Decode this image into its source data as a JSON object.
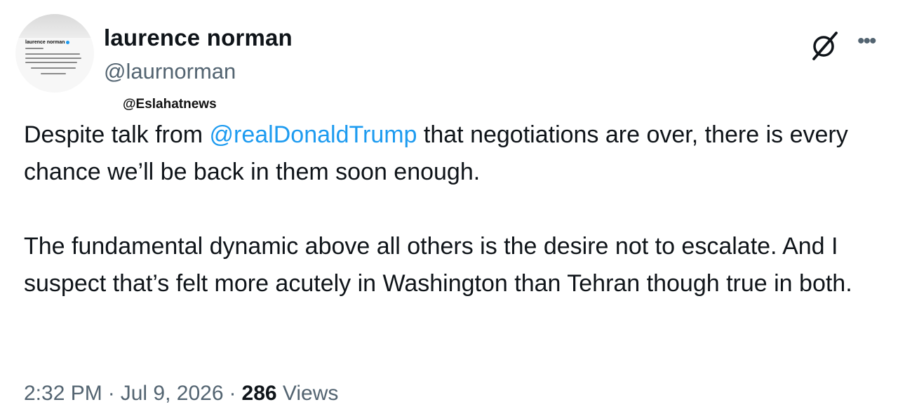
{
  "author": {
    "display_name": "laurence norman",
    "handle": "@laurnorman",
    "avatar_card_name": "laurence norman"
  },
  "watermark": "@Eslahatnews",
  "tweet": {
    "paragraph1_before": "Despite talk from ",
    "mention": "@realDonaldTrump",
    "paragraph1_after": " that negotiations are over, there is every chance we’ll be back in them soon enough.",
    "paragraph2": "The fundamental dynamic above all others is the desire not to escalate. And I suspect that’s felt more acutely in Washington than Tehran though true in both."
  },
  "meta": {
    "time": "2:32 PM",
    "separator": "·",
    "date": "Jul 9, 2026",
    "views_count": "286",
    "views_label": "Views"
  },
  "icons": {
    "grok": "grok-icon",
    "more": "more-icon",
    "verified": "verified-badge-icon"
  },
  "colors": {
    "accent": "#1d9bf0",
    "text": "#0f1419",
    "secondary": "#536471"
  }
}
